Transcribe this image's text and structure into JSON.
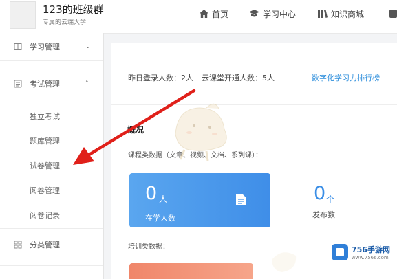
{
  "header": {
    "title": "123的班级群",
    "subtitle": "专属的云端大学",
    "nav": [
      {
        "label": "首页",
        "icon": "home-icon"
      },
      {
        "label": "学习中心",
        "icon": "graduation-cap-icon"
      },
      {
        "label": "知识商城",
        "icon": "library-icon"
      }
    ]
  },
  "sidebar": {
    "learning": {
      "label": "学习管理",
      "icon": "book-icon"
    },
    "exam": {
      "label": "考试管理",
      "icon": "exam-icon"
    },
    "exam_children": [
      "独立考试",
      "题库管理",
      "试卷管理",
      "阅卷管理",
      "阅卷记录"
    ],
    "category": {
      "label": "分类管理",
      "icon": "grid-icon"
    }
  },
  "stats": {
    "yesterday_login": "昨日登录人数：2人",
    "cloud_class_users": "云课堂开通人数：5人",
    "ranking_link": "数字化学习力排行榜"
  },
  "overview": {
    "title": "概况",
    "course_label": "课程类数据（文章、视频、文档、系列课）：",
    "learners": {
      "value": "0",
      "unit": "人",
      "caption": "在学人数",
      "icon": "document-icon"
    },
    "published": {
      "value": "0",
      "unit": "个",
      "caption": "发布数"
    },
    "training_label": "培训类数据："
  },
  "watermark": {
    "brand": "756手游网",
    "site": "www.7566.com"
  },
  "colors": {
    "accent_blue": "#3f8ee8",
    "link_blue": "#2f8fdc",
    "arrow_red": "#e0201a",
    "orange": "#f0866a"
  }
}
